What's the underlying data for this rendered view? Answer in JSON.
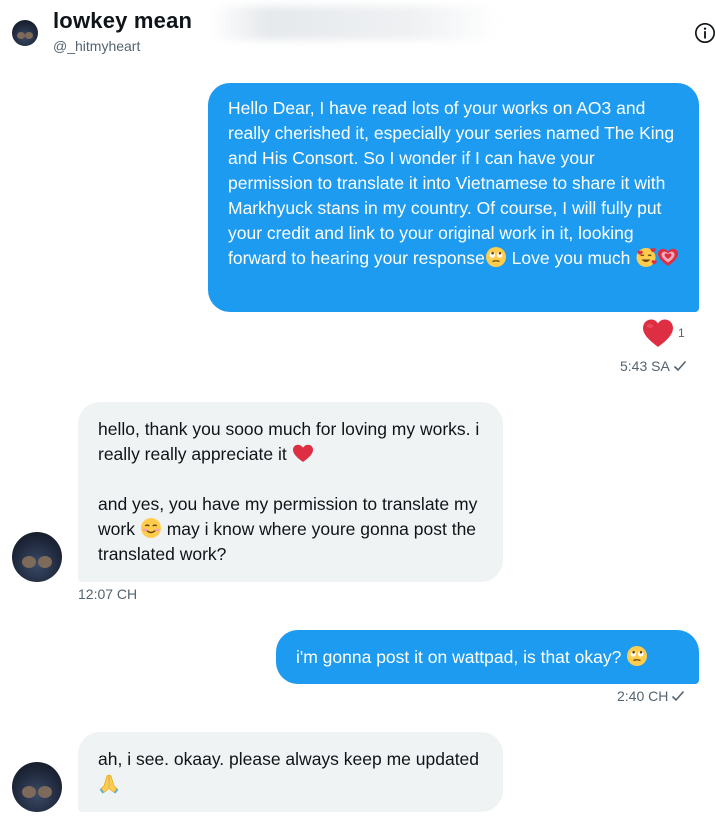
{
  "header": {
    "name": "lowkey mean",
    "handle": "@_hitmyheart"
  },
  "messages": [
    {
      "direction": "sent",
      "text_part1": "Hello Dear, I have read lots of your works on AO3 and really cherished it, especially your series named The King and His Consort. So I wonder if I can have your permission to translate it into Vietnamese to share it with Markhyuck stans in my country. Of course, I will fully put your credit and link to your original work in it, looking forward to hearing your response",
      "text_part2": " Love you much",
      "reaction_count": "1",
      "time": "5:43 SA"
    },
    {
      "direction": "received",
      "text_part1": "hello, thank you sooo much for loving my works. i really really appreciate it",
      "text_part2": "and yes, you have my permission to translate my work",
      "text_part3": " may i know where youre gonna post the translated work?",
      "time": "12:07 CH"
    },
    {
      "direction": "sent",
      "text": "i'm gonna post it on wattpad, is that okay?",
      "time": "2:40 CH"
    },
    {
      "direction": "received",
      "text": "ah, i see. okaay. please always keep me updated"
    }
  ],
  "icons": [
    "info-icon",
    "eye-roll-emoji",
    "smiling-face-with-hearts-emoji",
    "growing-heart-emoji",
    "red-heart-emoji",
    "blushing-smile-emoji",
    "folded-hands-emoji",
    "checkmark-icon"
  ],
  "colors": {
    "sent_bubble": "#1d9bf0",
    "received_bubble": "#eff3f4",
    "text_primary": "#0f1419",
    "text_secondary": "#536471",
    "heart": "#e0245e"
  }
}
